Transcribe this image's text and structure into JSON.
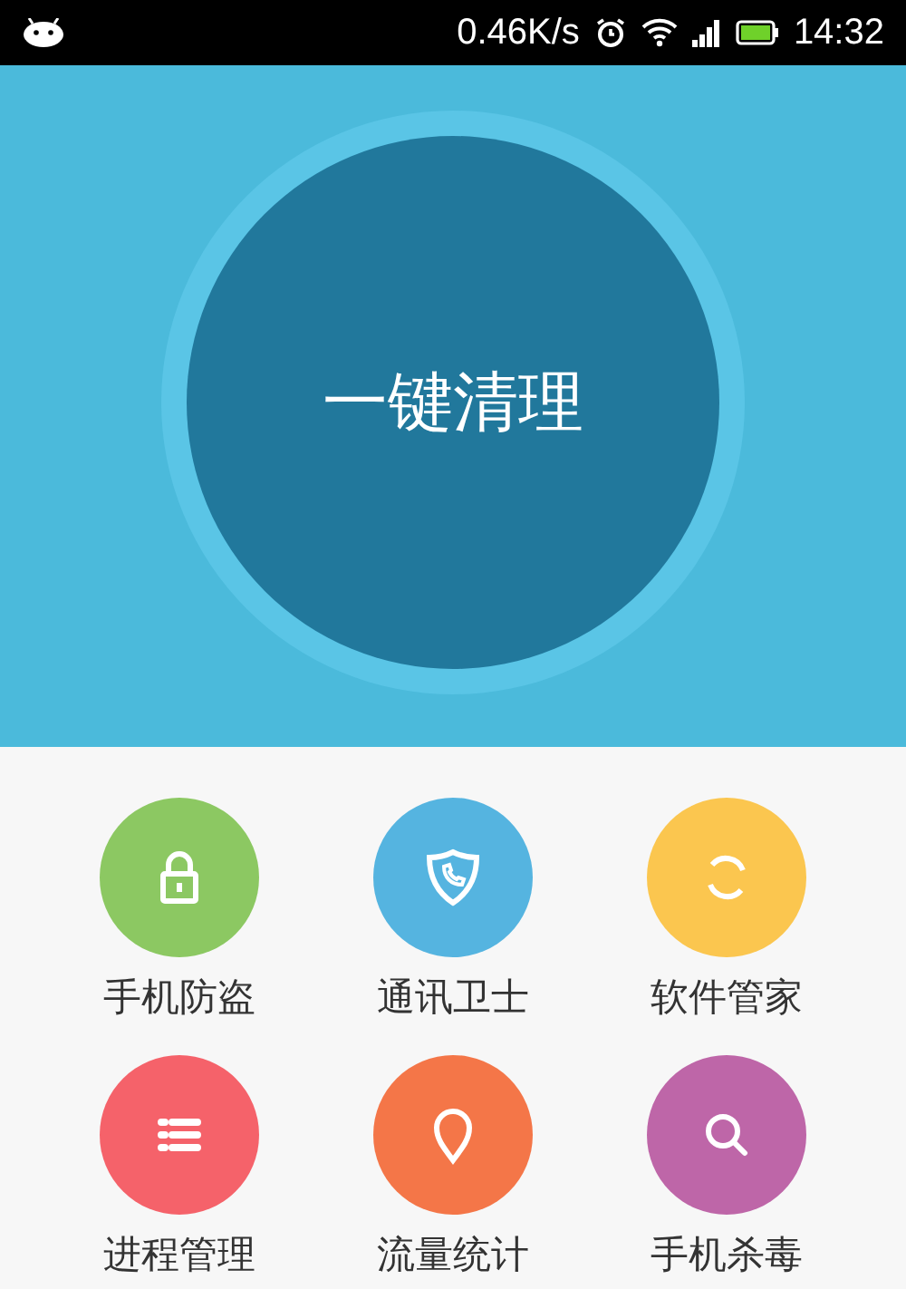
{
  "status_bar": {
    "speed": "0.46K/s",
    "time": "14:32"
  },
  "clean_button": {
    "label": "一键清理"
  },
  "features": [
    {
      "kind": "lock",
      "label": "手机防盗",
      "color": "#8cc862"
    },
    {
      "kind": "shield",
      "label": "通讯卫士",
      "color": "#55b4e0"
    },
    {
      "kind": "sync",
      "label": "软件管家",
      "color": "#fbc64f"
    },
    {
      "kind": "list",
      "label": "进程管理",
      "color": "#f5626a"
    },
    {
      "kind": "pin",
      "label": "流量统计",
      "color": "#f47648"
    },
    {
      "kind": "search",
      "label": "手机杀毒",
      "color": "#be66a8"
    }
  ]
}
